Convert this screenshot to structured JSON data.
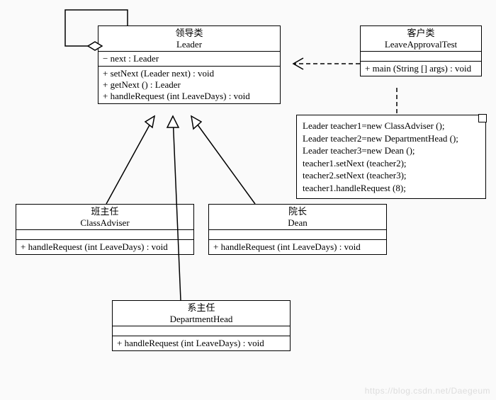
{
  "classes": {
    "leader": {
      "title_cn": "领导类",
      "title_en": "Leader",
      "attrs": [
        "− next : Leader"
      ],
      "ops": [
        "+ setNext (Leader next) : void",
        "+ getNext () : Leader",
        "+ handleRequest (int LeaveDays) : void"
      ]
    },
    "client": {
      "title_cn": "客户类",
      "title_en": "LeaveApprovalTest",
      "ops": [
        "+ main (String [] args) : void"
      ]
    },
    "classAdviser": {
      "title_cn": "班主任",
      "title_en": "ClassAdviser",
      "ops": [
        "+ handleRequest (int LeaveDays) : void"
      ]
    },
    "dean": {
      "title_cn": "院长",
      "title_en": "Dean",
      "ops": [
        "+ handleRequest (int LeaveDays) : void"
      ]
    },
    "departmentHead": {
      "title_cn": "系主任",
      "title_en": "DepartmentHead",
      "ops": [
        "+ handleRequest (int LeaveDays) : void"
      ]
    }
  },
  "note_lines": [
    "Leader teacher1=new ClassAdviser ();",
    "Leader teacher2=new DepartmentHead ();",
    "Leader teacher3=new Dean ();",
    "teacher1.setNext (teacher2);",
    "teacher2.setNext (teacher3);",
    "teacher1.handleRequest (8);"
  ],
  "watermark": "https://blog.csdn.net/Daegeum",
  "diagram_semantics": {
    "pattern": "Chain of Responsibility",
    "abstract_handler": "Leader",
    "concrete_handlers": [
      "ClassAdviser",
      "DepartmentHead",
      "Dean"
    ],
    "client": "LeaveApprovalTest",
    "relationships": [
      {
        "type": "generalization",
        "from": "ClassAdviser",
        "to": "Leader"
      },
      {
        "type": "generalization",
        "from": "DepartmentHead",
        "to": "Leader"
      },
      {
        "type": "generalization",
        "from": "Dean",
        "to": "Leader"
      },
      {
        "type": "self-aggregation",
        "whole": "Leader",
        "part": "Leader",
        "role": "next"
      },
      {
        "type": "dependency",
        "from": "LeaveApprovalTest",
        "to": "Leader"
      },
      {
        "type": "note-anchor",
        "from": "note",
        "to": "LeaveApprovalTest"
      }
    ]
  }
}
